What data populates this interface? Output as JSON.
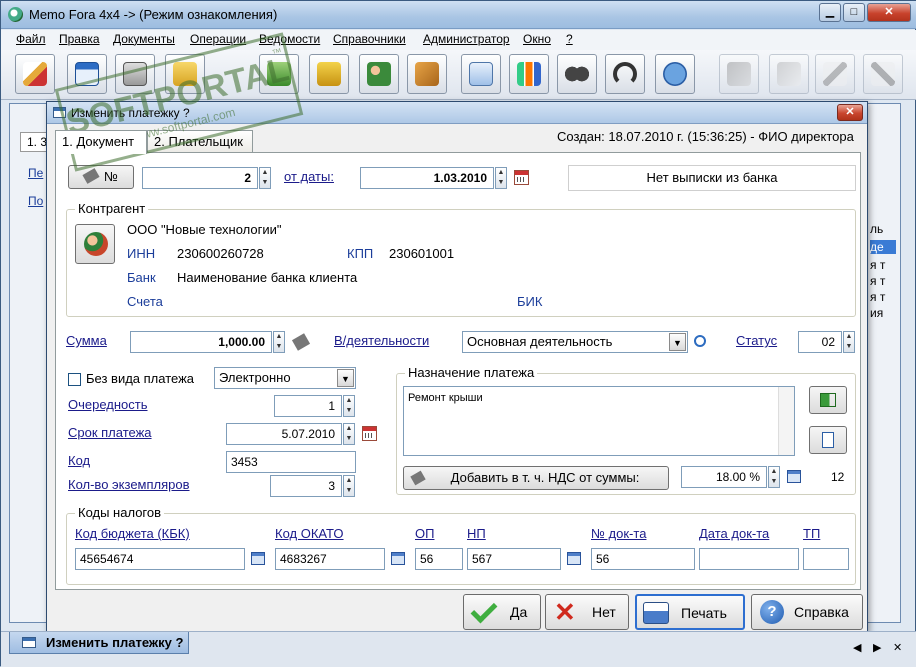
{
  "window": {
    "title": "Memo Fora 4x4 -> (Режим ознакомления)",
    "min": "▁",
    "max": "□",
    "close": "✕"
  },
  "menu": [
    "Файл",
    "Правка",
    "Документы",
    "Операции",
    "Ведомости",
    "Справочники",
    "Администратор",
    "Окно",
    "?"
  ],
  "toolbar": [
    "pen-icon",
    "card-icon",
    "cash-register-icon",
    "folder-add-icon",
    "calculator-icon",
    "forklift-icon",
    "users-icon",
    "box-icon",
    "person-card-icon",
    "bar-chart-icon",
    "binoculars-icon",
    "headset-icon",
    "chat-icon",
    "phone-out-icon",
    "note-icon",
    "pencil-icon",
    "tools-icon"
  ],
  "background": {
    "tab1": "1. 3",
    "left_labels": [
      "Пе",
      "По"
    ],
    "right_cells": [
      "ль",
      "де",
      "я т",
      "я т",
      "я т",
      "ия"
    ]
  },
  "watermark": {
    "text": "SOFTPORTAL",
    "url": "www.softportal.com",
    "tm": "™"
  },
  "dialog": {
    "title": "Изменить платежку ?",
    "tabs": [
      "1. Документ",
      "2. Плательщик"
    ],
    "created": "Создан: 18.07.2010 г. (15:36:25) - ФИО директора",
    "number_btn": "№",
    "number": "2",
    "date_label": "от даты:",
    "date": "1.03.2010",
    "bank_status": "Нет выписки из банка",
    "counterparty": {
      "group": "Контрагент",
      "name": "ООО \"Новые технологии\"",
      "inn_label": "ИНН",
      "inn": "230600260728",
      "kpp_label": "КПП",
      "kpp": "230601001",
      "bank_label": "Банк",
      "bank": "Наименование банка клиента",
      "accounts_label": "Счета",
      "bik_label": "БИК"
    },
    "sum_label": "Сумма",
    "sum": "1,000.00",
    "activity_label": "В/деятельности",
    "activity": "Основная деятельность",
    "status_label": "Статус",
    "status": "02",
    "no_payment_type": "Без вида платежа",
    "payment_type": "Электронно",
    "order_label": "Очередность",
    "order": "1",
    "due_label": "Срок платежа",
    "due": "5.07.2010",
    "code_label": "Код",
    "code": "3453",
    "copies_label": "Кол-во экземпляров",
    "copies": "3",
    "purpose": {
      "group": "Назначение платежа",
      "text": "Ремонт крыши",
      "vat_btn": "Добавить в т. ч. НДС от суммы:",
      "vat": "18.00 %",
      "count": "12"
    },
    "tax": {
      "group": "Коды налогов",
      "kbk_label": "Код бюджета (КБК)",
      "kbk": "45654674",
      "okato_label": "Код ОКАТО",
      "okato": "4683267",
      "op_label": "ОП",
      "op": "56",
      "np_label": "НП",
      "np": "567",
      "doc_label": "№ док-та",
      "doc": "56",
      "docdate_label": "Дата док-та",
      "docdate": "",
      "tp_label": "ТП",
      "tp": ""
    },
    "buttons": {
      "yes": "Да",
      "no": "Нет",
      "print": "Печать",
      "help": "Справка"
    }
  },
  "status": {
    "task": "Изменить платежку ?",
    "nav_left": "◀",
    "nav_right": "▶",
    "close": "✕"
  }
}
